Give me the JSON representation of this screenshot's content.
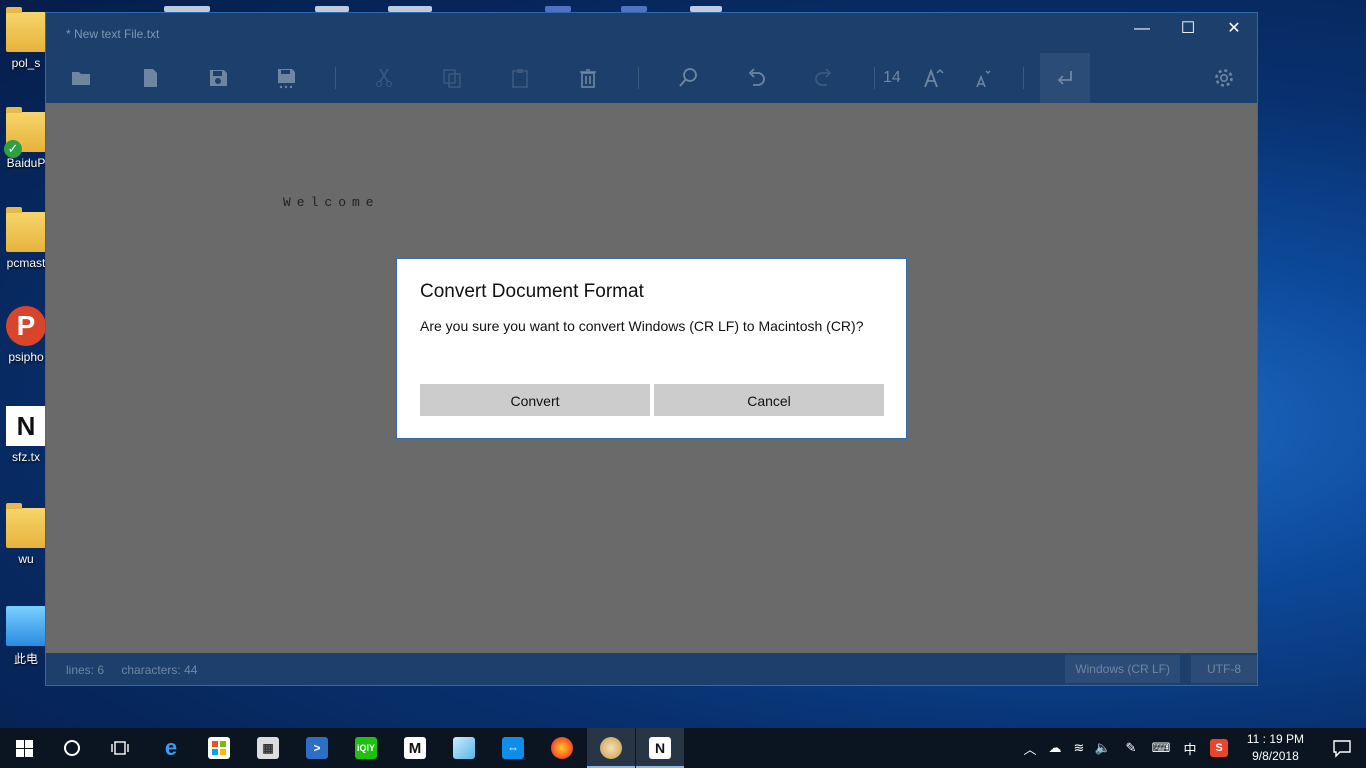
{
  "desktop": {
    "icons": [
      {
        "label": "pol_s"
      },
      {
        "label": "BaiduP"
      },
      {
        "label": "pcmast"
      },
      {
        "label": "psipho"
      },
      {
        "label": "sfz.tx"
      },
      {
        "label": "wu"
      },
      {
        "label": "此电"
      }
    ]
  },
  "window": {
    "title": "* New text File.txt",
    "minimize": "—",
    "maximize": "☐",
    "close": "✕"
  },
  "toolbar": {
    "font_size": "14",
    "icons": [
      "open-folder-icon",
      "new-file-icon",
      "save-icon",
      "save-as-icon",
      "cut-icon",
      "copy-icon",
      "paste-icon",
      "delete-icon",
      "find-icon",
      "undo-icon",
      "redo-icon",
      "increase-font-icon",
      "decrease-font-icon",
      "word-wrap-icon",
      "settings-icon"
    ]
  },
  "editor": {
    "content": "Welcome"
  },
  "status": {
    "lines": "lines: 6",
    "characters": "characters: 44",
    "line_ending": "Windows (CR LF)",
    "encoding": "UTF-8"
  },
  "dialog": {
    "title": "Convert Document Format",
    "message": "Are you sure you want to convert Windows (CR LF) to Macintosh (CR)?",
    "confirm_label": "Convert",
    "cancel_label": "Cancel"
  },
  "taskbar": {
    "time": "11 : 19 PM",
    "date": "9/8/2018",
    "ime": "中",
    "apps": [
      "start-icon",
      "cortana-icon",
      "task-view-icon",
      "edge-icon",
      "store-icon",
      "calculator-icon",
      "powershell-icon",
      "iqiyi-icon",
      "mango-tv-icon",
      "notes-icon",
      "teamviewer-icon",
      "firefox-icon",
      "paint-icon",
      "notepads-icon"
    ]
  },
  "colors": {
    "accent": "#1c3f6b",
    "dialog_border": "#2d6ab0",
    "button_bg": "#cccccc"
  }
}
